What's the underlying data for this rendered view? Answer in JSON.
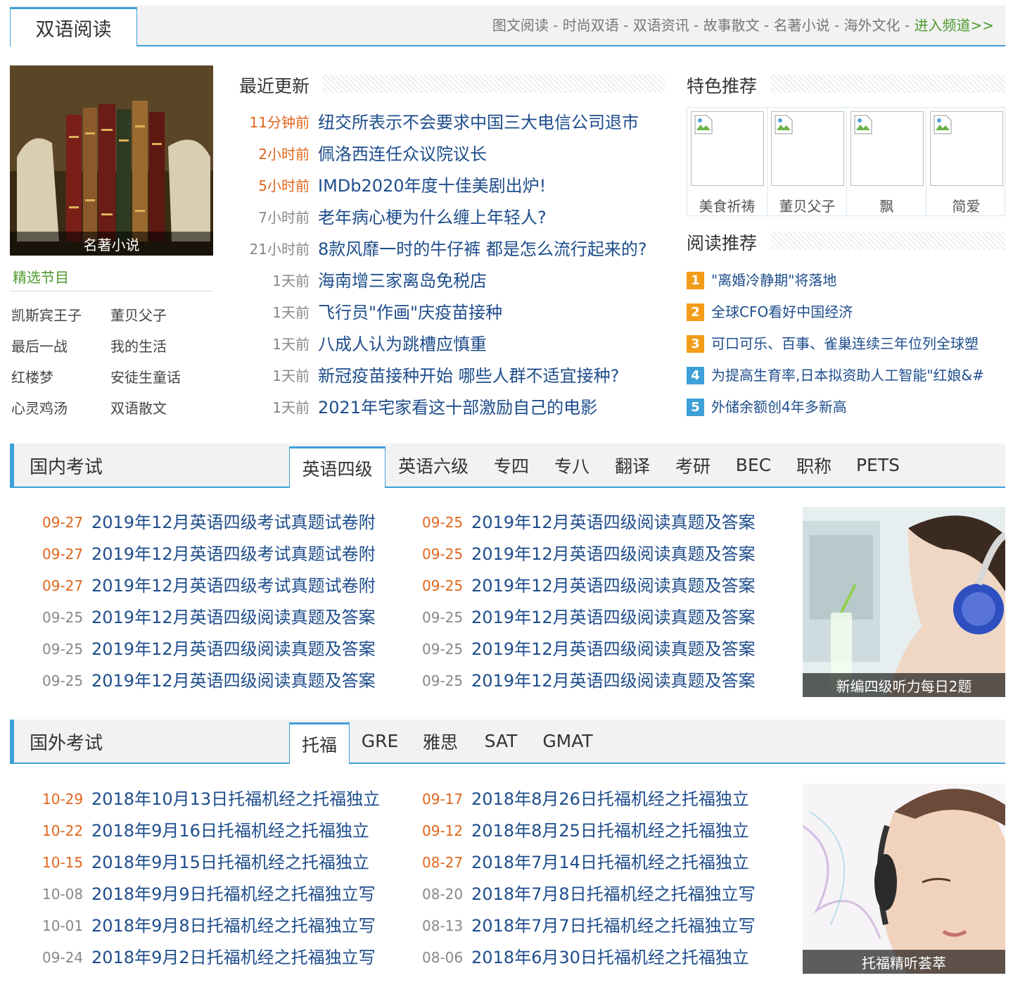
{
  "channel": {
    "tab_label": "双语阅读",
    "nav": [
      "图文阅读",
      "时尚双语",
      "双语资讯",
      "故事散文",
      "名著小说",
      "海外文化"
    ],
    "separator": " - ",
    "more_label": "进入频道>>"
  },
  "feature": {
    "caption": "名著小说"
  },
  "selected": {
    "title": "精选节目",
    "items": [
      "凯斯宾王子",
      "董贝父子",
      "最后一战",
      "我的生活",
      "红楼梦",
      "安徒生童话",
      "心灵鸡汤",
      "双语散文"
    ]
  },
  "recent": {
    "title": "最近更新",
    "items": [
      {
        "time": "11分钟前",
        "title": "纽交所表示不会要求中国三大电信公司退市"
      },
      {
        "time": "2小时前",
        "title": "佩洛西连任众议院议长"
      },
      {
        "time": "5小时前",
        "title": "IMDb2020年度十佳美剧出炉!"
      },
      {
        "time": "7小时前",
        "title": "老年病心梗为什么缠上年轻人?"
      },
      {
        "time": "21小时前",
        "title": "8款风靡一时的牛仔裤 都是怎么流行起来的?"
      },
      {
        "time": "1天前",
        "title": "海南增三家离岛免税店"
      },
      {
        "time": "1天前",
        "title": "飞行员\"作画\"庆疫苗接种"
      },
      {
        "time": "1天前",
        "title": "八成人认为跳槽应慎重"
      },
      {
        "time": "1天前",
        "title": "新冠疫苗接种开始 哪些人群不适宜接种?"
      },
      {
        "time": "1天前",
        "title": "2021年宅家看这十部激励自己的电影"
      }
    ]
  },
  "featured": {
    "title": "特色推荐",
    "items": [
      "美食祈祷",
      "董贝父子",
      "飘",
      "简爱"
    ]
  },
  "reading": {
    "title": "阅读推荐",
    "items": [
      {
        "rank": "1",
        "title": "\"离婚冷静期\"将落地"
      },
      {
        "rank": "2",
        "title": "全球CFO看好中国经济"
      },
      {
        "rank": "3",
        "title": "可口可乐、百事、雀巢连续三年位列全球塑"
      },
      {
        "rank": "4",
        "title": "为提高生育率,日本拟资助人工智能\"红娘&#"
      },
      {
        "rank": "5",
        "title": "外储余额创4年多新高"
      }
    ]
  },
  "domestic": {
    "name": "国内考试",
    "tabs": [
      "英语四级",
      "英语六级",
      "专四",
      "专八",
      "翻译",
      "考研",
      "BEC",
      "职称",
      "PETS"
    ],
    "left": [
      {
        "date": "09-27",
        "title": "2019年12月英语四级考试真题试卷附"
      },
      {
        "date": "09-27",
        "title": "2019年12月英语四级考试真题试卷附"
      },
      {
        "date": "09-27",
        "title": "2019年12月英语四级考试真题试卷附"
      },
      {
        "date": "09-25",
        "title": "2019年12月英语四级阅读真题及答案"
      },
      {
        "date": "09-25",
        "title": "2019年12月英语四级阅读真题及答案"
      },
      {
        "date": "09-25",
        "title": "2019年12月英语四级阅读真题及答案"
      }
    ],
    "right": [
      {
        "date": "09-25",
        "title": "2019年12月英语四级阅读真题及答案"
      },
      {
        "date": "09-25",
        "title": "2019年12月英语四级阅读真题及答案"
      },
      {
        "date": "09-25",
        "title": "2019年12月英语四级阅读真题及答案"
      },
      {
        "date": "09-25",
        "title": "2019年12月英语四级阅读真题及答案"
      },
      {
        "date": "09-25",
        "title": "2019年12月英语四级阅读真题及答案"
      },
      {
        "date": "09-25",
        "title": "2019年12月英语四级阅读真题及答案"
      }
    ],
    "pic_caption": "新编四级听力每日2题"
  },
  "foreign": {
    "name": "国外考试",
    "tabs": [
      "托福",
      "GRE",
      "雅思",
      "SAT",
      "GMAT"
    ],
    "left": [
      {
        "date": "10-29",
        "title": "2018年10月13日托福机经之托福独立"
      },
      {
        "date": "10-22",
        "title": "2018年9月16日托福机经之托福独立"
      },
      {
        "date": "10-15",
        "title": "2018年9月15日托福机经之托福独立"
      },
      {
        "date": "10-08",
        "title": "2018年9月9日托福机经之托福独立写"
      },
      {
        "date": "10-01",
        "title": "2018年9月8日托福机经之托福独立写"
      },
      {
        "date": "09-24",
        "title": "2018年9月2日托福机经之托福独立写"
      }
    ],
    "right": [
      {
        "date": "09-17",
        "title": "2018年8月26日托福机经之托福独立"
      },
      {
        "date": "09-12",
        "title": "2018年8月25日托福机经之托福独立"
      },
      {
        "date": "08-27",
        "title": "2018年7月14日托福机经之托福独立"
      },
      {
        "date": "08-20",
        "title": "2018年7月8日托福机经之托福独立写"
      },
      {
        "date": "08-13",
        "title": "2018年7月7日托福机经之托福独立写"
      },
      {
        "date": "08-06",
        "title": "2018年6月30日托福机经之托福独立"
      }
    ],
    "pic_caption": "托福精听荟萃"
  },
  "colors": {
    "accent": "#3ea0d8",
    "hot": "#e0651c",
    "link": "#1e4d8c",
    "green": "#4d9a2d",
    "rank_orange": "#f39c1a"
  },
  "icons": {
    "broken_image": "broken-image-icon",
    "headphones": "headphones-icon"
  }
}
